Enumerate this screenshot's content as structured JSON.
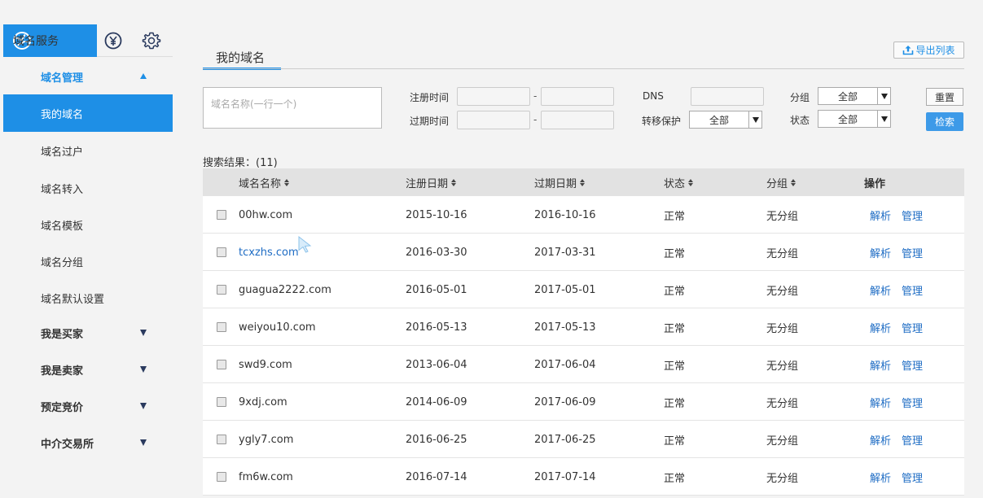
{
  "sidebar": {
    "service_tab": "域名服务",
    "items": [
      {
        "label": "域名管理",
        "type": "group-open"
      },
      {
        "label": "我的域名",
        "type": "active"
      },
      {
        "label": "域名过户",
        "type": "item"
      },
      {
        "label": "域名转入",
        "type": "item"
      },
      {
        "label": "域名模板",
        "type": "item"
      },
      {
        "label": "域名分组",
        "type": "item"
      },
      {
        "label": "域名默认设置",
        "type": "item"
      },
      {
        "label": "我是买家",
        "type": "group"
      },
      {
        "label": "我是卖家",
        "type": "group"
      },
      {
        "label": "预定竞价",
        "type": "group"
      },
      {
        "label": "中介交易所",
        "type": "group"
      }
    ]
  },
  "main": {
    "tab_title": "我的域名",
    "export_label": "导出列表",
    "filters": {
      "domain_placeholder": "域名名称(一行一个)",
      "reg_time_label": "注册时间",
      "exp_time_label": "过期时间",
      "dash": "-",
      "dns_label": "DNS",
      "transfer_protect_label": "转移保护",
      "transfer_protect_value": "全部",
      "group_label": "分组",
      "group_value": "全部",
      "status_label": "状态",
      "status_value": "全部",
      "reset_label": "重置",
      "search_label": "检索"
    },
    "result_count": "搜索结果：(11)",
    "table": {
      "headers": {
        "name": "域名名称",
        "reg": "注册日期",
        "exp": "过期日期",
        "status": "状态",
        "group": "分组",
        "ops": "操作"
      },
      "rows": [
        {
          "name": "00hw.com",
          "reg": "2015-10-16",
          "exp": "2016-10-16",
          "status": "正常",
          "group": "无分组",
          "resolve": "解析",
          "manage": "管理"
        },
        {
          "name": "tcxzhs.com",
          "reg": "2016-03-30",
          "exp": "2017-03-31",
          "status": "正常",
          "group": "无分组",
          "resolve": "解析",
          "manage": "管理"
        },
        {
          "name": "guagua2222.com",
          "reg": "2016-05-01",
          "exp": "2017-05-01",
          "status": "正常",
          "group": "无分组",
          "resolve": "解析",
          "manage": "管理"
        },
        {
          "name": "weiyou10.com",
          "reg": "2016-05-13",
          "exp": "2017-05-13",
          "status": "正常",
          "group": "无分组",
          "resolve": "解析",
          "manage": "管理"
        },
        {
          "name": "swd9.com",
          "reg": "2013-06-04",
          "exp": "2017-06-04",
          "status": "正常",
          "group": "无分组",
          "resolve": "解析",
          "manage": "管理"
        },
        {
          "name": "9xdj.com",
          "reg": "2014-06-09",
          "exp": "2017-06-09",
          "status": "正常",
          "group": "无分组",
          "resolve": "解析",
          "manage": "管理"
        },
        {
          "name": "ygly7.com",
          "reg": "2016-06-25",
          "exp": "2017-06-25",
          "status": "正常",
          "group": "无分组",
          "resolve": "解析",
          "manage": "管理"
        },
        {
          "name": "fm6w.com",
          "reg": "2016-07-14",
          "exp": "2017-07-14",
          "status": "正常",
          "group": "无分组",
          "resolve": "解析",
          "manage": "管理"
        }
      ]
    }
  }
}
